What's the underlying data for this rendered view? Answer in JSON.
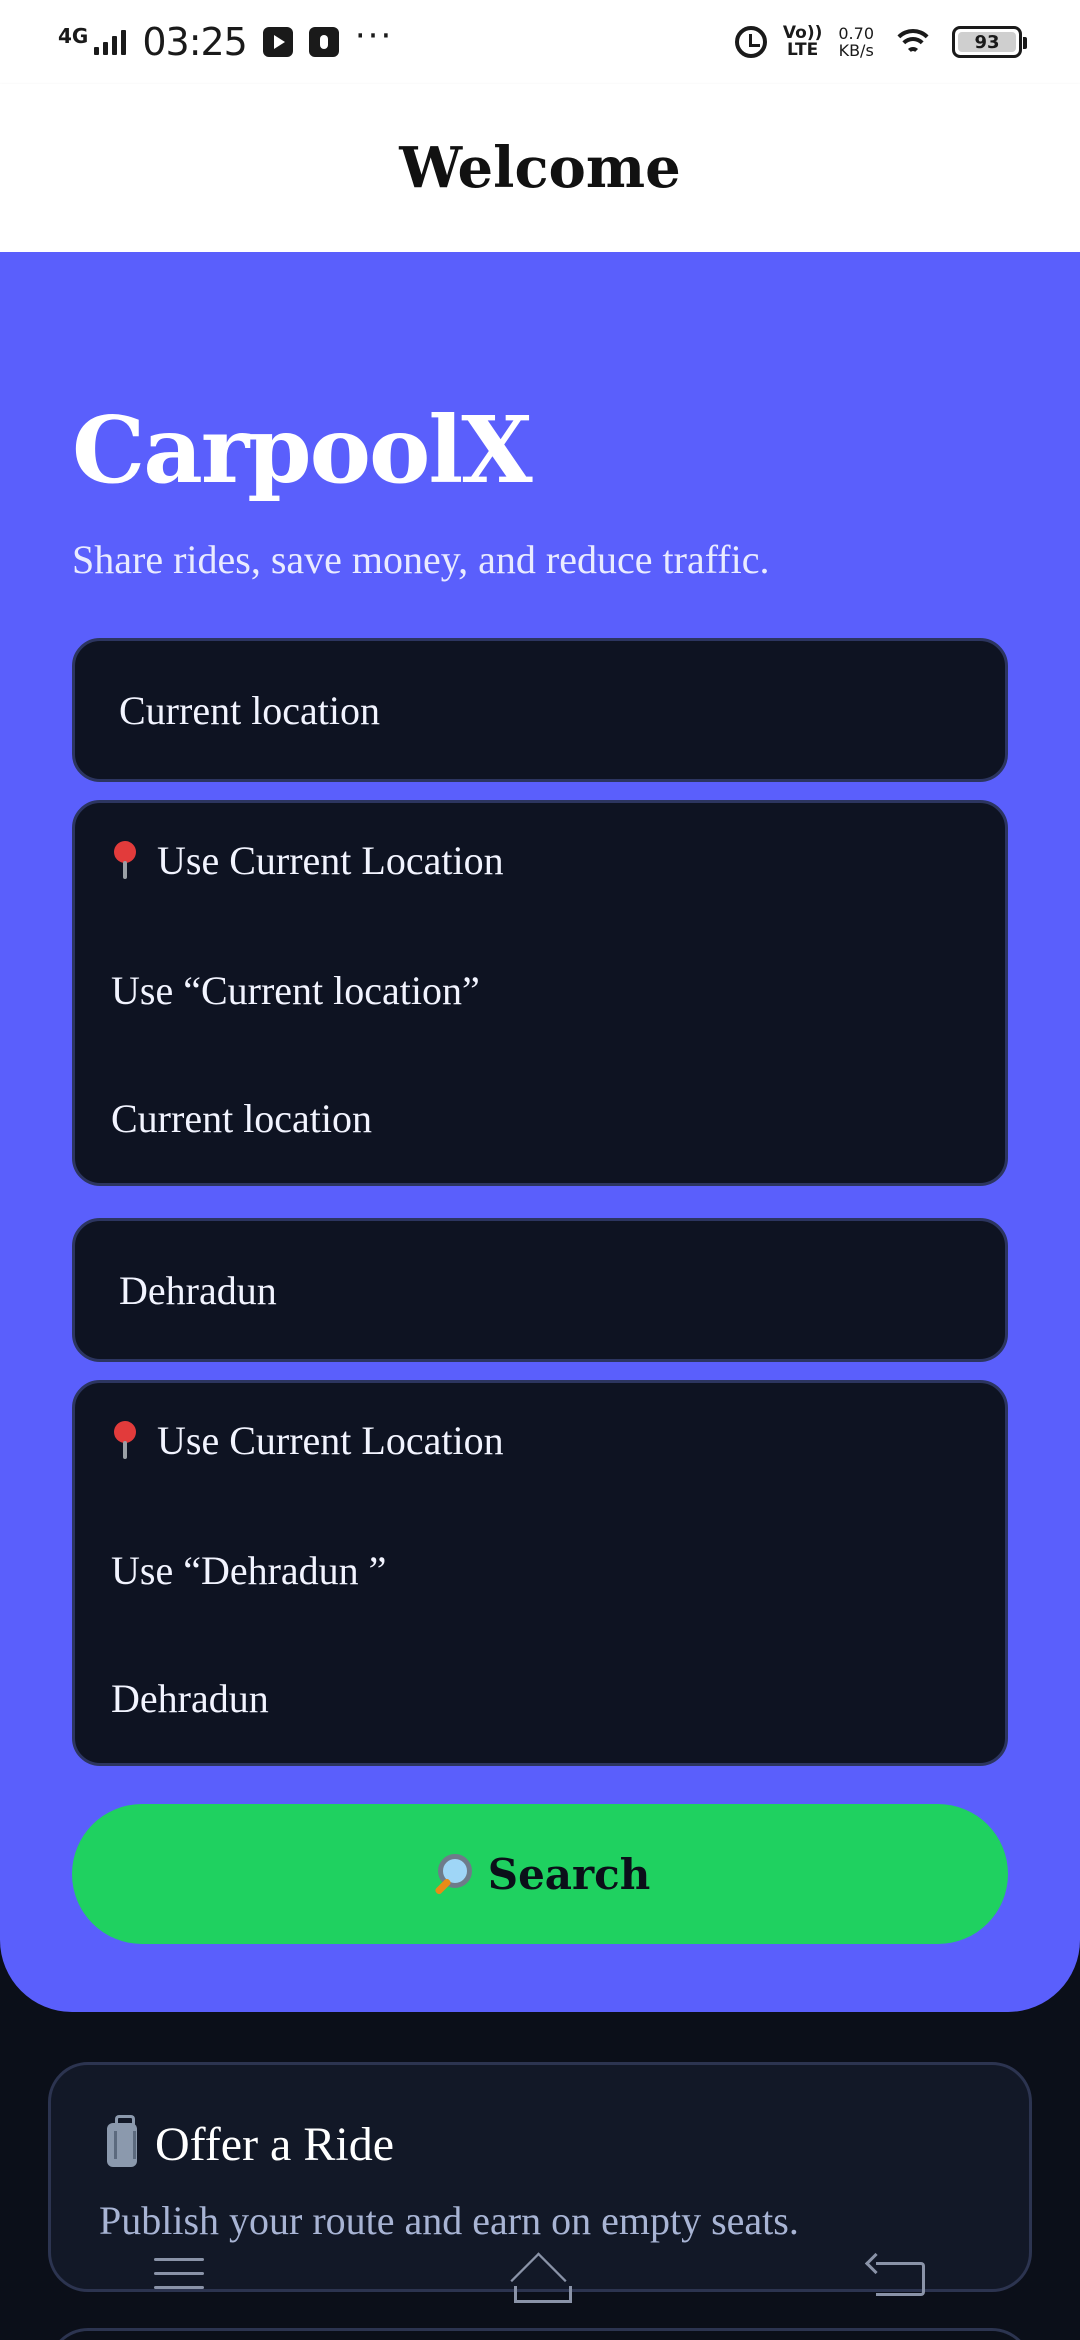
{
  "status_bar": {
    "network": "4G",
    "time": "03:25",
    "more": "···",
    "volte_top": "Vo))",
    "volte_bottom": "LTE",
    "speed_value": "0.70",
    "speed_unit": "KB/s",
    "battery_level": "93"
  },
  "header": {
    "title": "Welcome"
  },
  "hero": {
    "brand": "CarpoolX",
    "tagline": "Share rides, save money, and reduce traffic."
  },
  "origin": {
    "value": "Current location",
    "suggestions": {
      "use_current": "Use Current Location",
      "use_typed": "Use “Current location”",
      "result": "Current location"
    }
  },
  "destination": {
    "value": "Dehradun",
    "suggestions": {
      "use_current": "Use Current Location",
      "use_typed": "Use “Dehradun ”",
      "result": "Dehradun"
    }
  },
  "search_button": {
    "label": "Search"
  },
  "offer_card": {
    "title": "Offer a Ride",
    "description": "Publish your route and earn on empty seats."
  },
  "colors": {
    "hero_bg": "#5a5ffc",
    "field_bg": "#0e1322",
    "search_btn": "#1fd160",
    "page_bg": "#0b0f19"
  }
}
